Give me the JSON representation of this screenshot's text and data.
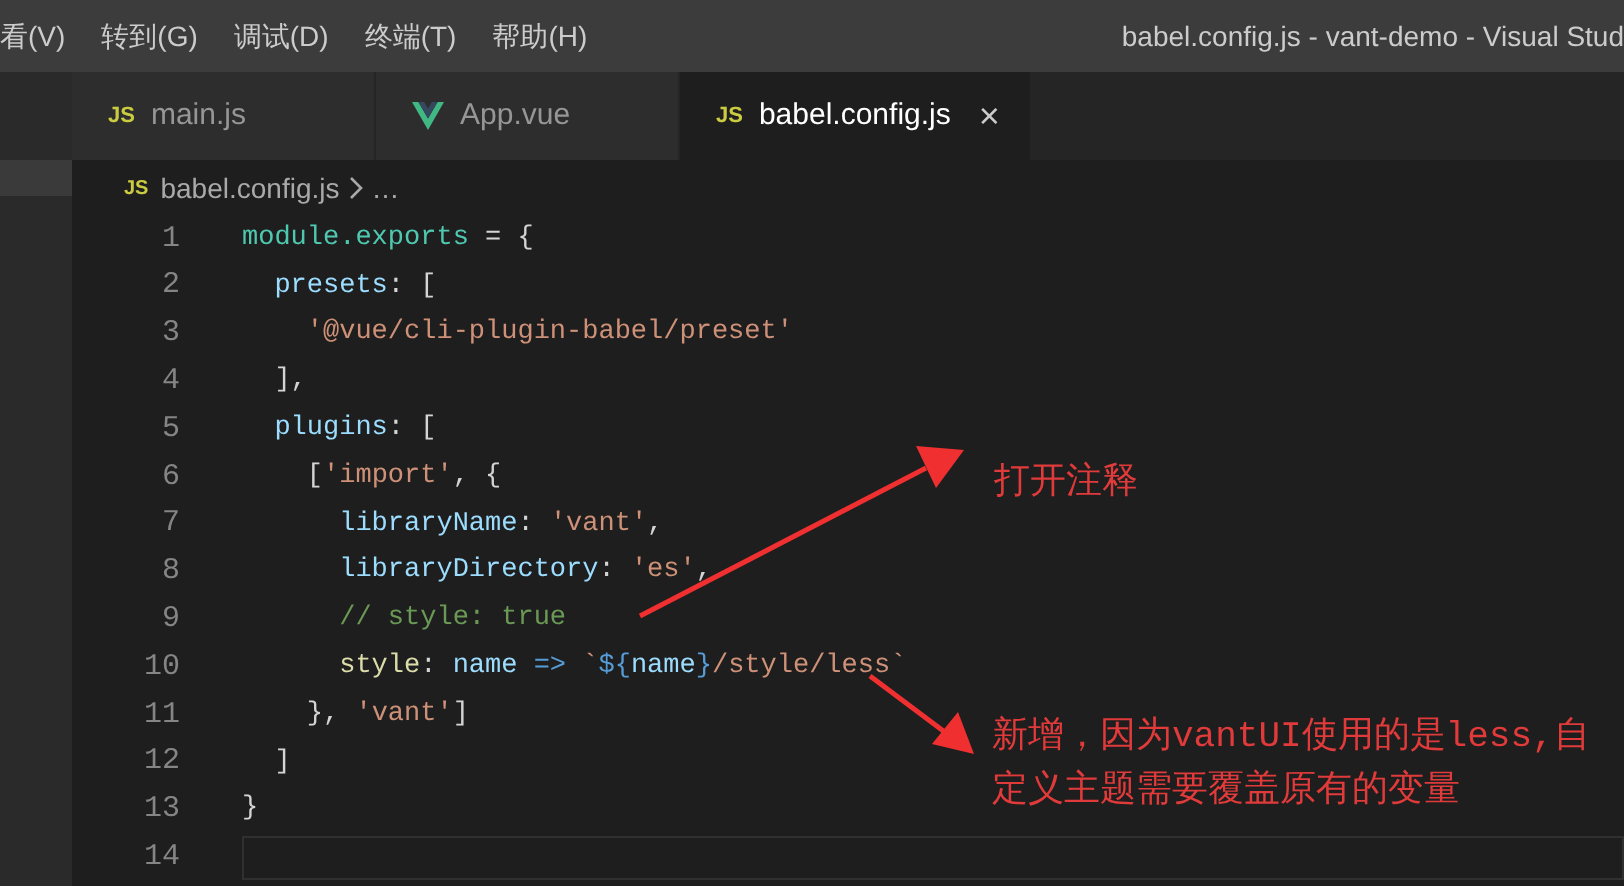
{
  "menu": [
    "看(V)",
    "转到(G)",
    "调试(D)",
    "终端(T)",
    "帮助(H)"
  ],
  "window": {
    "title": "babel.config.js - vant-demo - Visual Stud"
  },
  "tabs": [
    {
      "kind": "js",
      "badge": "JS",
      "label": "main.js",
      "selected": false
    },
    {
      "kind": "vue",
      "label": "App.vue",
      "selected": false
    },
    {
      "kind": "js",
      "badge": "JS",
      "label": "babel.config.js",
      "selected": true,
      "close": "×"
    }
  ],
  "breadcrumb": {
    "badge": "JS",
    "file": "babel.config.js",
    "rest": "…"
  },
  "lines": [
    {
      "number": "1",
      "tokens": [
        {
          "kind": "type",
          "text": "module.exports"
        },
        {
          "kind": "punct",
          "text": " = {"
        }
      ]
    },
    {
      "number": "2",
      "tokens": [
        {
          "kind": "prop",
          "text": "  presets"
        },
        {
          "kind": "punct",
          "text": ": ["
        }
      ]
    },
    {
      "number": "3",
      "tokens": [
        {
          "kind": "string",
          "text": "    '@vue/cli-plugin-babel/preset'"
        }
      ]
    },
    {
      "number": "4",
      "tokens": [
        {
          "kind": "punct",
          "text": "  ],"
        }
      ]
    },
    {
      "number": "5",
      "tokens": [
        {
          "kind": "prop",
          "text": "  plugins"
        },
        {
          "kind": "punct",
          "text": ": ["
        }
      ]
    },
    {
      "number": "6",
      "tokens": [
        {
          "kind": "punct",
          "text": "    ["
        },
        {
          "kind": "string",
          "text": "'import'"
        },
        {
          "kind": "punct",
          "text": ", {"
        }
      ]
    },
    {
      "number": "7",
      "tokens": [
        {
          "kind": "prop",
          "text": "      libraryName"
        },
        {
          "kind": "punct",
          "text": ": "
        },
        {
          "kind": "string",
          "text": "'vant'"
        },
        {
          "kind": "punct",
          "text": ","
        }
      ]
    },
    {
      "number": "8",
      "tokens": [
        {
          "kind": "prop",
          "text": "      libraryDirectory"
        },
        {
          "kind": "punct",
          "text": ": "
        },
        {
          "kind": "string",
          "text": "'es'"
        },
        {
          "kind": "punct",
          "text": ","
        }
      ]
    },
    {
      "number": "9",
      "tokens": [
        {
          "kind": "comment",
          "text": "      // style: true"
        }
      ]
    },
    {
      "number": "10",
      "tokens": [
        {
          "kind": "plain",
          "text": "      style"
        },
        {
          "kind": "punct",
          "text": ": "
        },
        {
          "kind": "prop",
          "text": "name"
        },
        {
          "kind": "keyword",
          "text": " =>"
        },
        {
          "kind": "string",
          "text": " `"
        },
        {
          "kind": "keyword",
          "text": "${"
        },
        {
          "kind": "prop",
          "text": "name"
        },
        {
          "kind": "keyword",
          "text": "}"
        },
        {
          "kind": "string",
          "text": "/style/less`"
        }
      ]
    },
    {
      "number": "11",
      "tokens": [
        {
          "kind": "punct",
          "text": "    }, "
        },
        {
          "kind": "string",
          "text": "'vant'"
        },
        {
          "kind": "punct",
          "text": "]"
        }
      ]
    },
    {
      "number": "12",
      "tokens": [
        {
          "kind": "punct",
          "text": "  ]"
        }
      ]
    },
    {
      "number": "13",
      "tokens": [
        {
          "kind": "punct",
          "text": "}"
        }
      ]
    },
    {
      "number": "14"
    }
  ],
  "annotations": [
    "打开注释",
    "新增，因为vantUI使用的是less,自定义主题需要覆盖原有的变量"
  ]
}
